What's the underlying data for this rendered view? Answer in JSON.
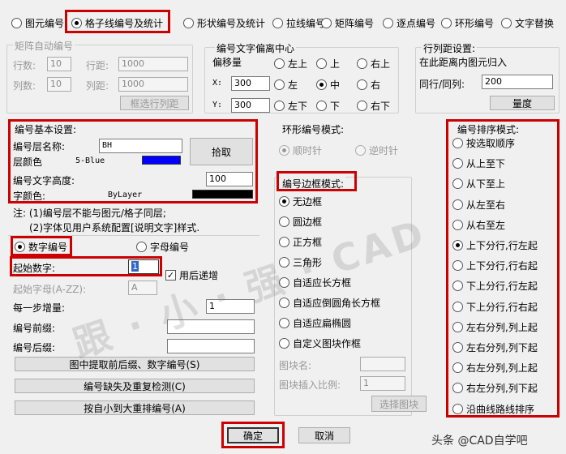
{
  "tabs": [
    {
      "label": "图元编号",
      "selected": false
    },
    {
      "label": "格子线编号及统计",
      "selected": true
    },
    {
      "label": "形状编号及统计",
      "selected": false
    },
    {
      "label": "拉线编号",
      "selected": false
    },
    {
      "label": "矩阵编号",
      "selected": false
    },
    {
      "label": "逐点编号",
      "selected": false
    },
    {
      "label": "环形编号",
      "selected": false
    },
    {
      "label": "文字替换",
      "selected": false
    }
  ],
  "matrix": {
    "title": "矩阵自动编号",
    "rows_label": "行数:",
    "rows_value": "10",
    "rowspace_label": "行距:",
    "rowspace_value": "1000",
    "cols_label": "列数:",
    "cols_value": "10",
    "colspace_label": "列距:",
    "colspace_value": "1000",
    "pick_button": "框选行列距"
  },
  "offset": {
    "title": "编号文字偏离中心",
    "move_label": "偏移量",
    "x_label": "X:",
    "x_value": "300",
    "y_label": "Y:",
    "y_value": "300",
    "positions": [
      "左上",
      "上",
      "右上",
      "左",
      "中",
      "右",
      "左下",
      "下",
      "右下"
    ],
    "selected": "中"
  },
  "rowcol": {
    "title": "行列距设置:",
    "desc": "在此距离内图元归入",
    "same_label": "同行/同列:",
    "same_value": "200",
    "measure_button": "量度"
  },
  "basic": {
    "title": "编号基本设置:",
    "layer_label": "编号层名称:",
    "layer_value": "BH",
    "pick_button": "拾取",
    "layer_color_label": "层颜色",
    "layer_color_text": "5-Blue",
    "layer_color": "#0000ff",
    "height_label": "编号文字高度:",
    "height_value": "100",
    "font_color_label": "字颜色:",
    "font_color_text": "ByLayer",
    "font_color": "#000000"
  },
  "note": {
    "line1": "注: (1)编号层不能与图元/格子同层;",
    "line2": "(2)字体见用户系统配置[说明文字]样式."
  },
  "numtype": {
    "digit_label": "数字编号",
    "alpha_label": "字母编号",
    "selected": "数字编号"
  },
  "start": {
    "label": "起始数字:",
    "value": "1",
    "autoinc_label": "用后递增",
    "autoinc_checked": true,
    "alpha_label": "起始字母(A-ZZ):",
    "alpha_value": "A",
    "step_label": "每一步增量:",
    "step_value": "1",
    "prefix_label": "编号前缀:",
    "prefix_value": "",
    "suffix_label": "编号后缀:",
    "suffix_value": ""
  },
  "actions": {
    "extract": "图中提取前后缀、数字编号(S)",
    "check": "编号缺失及重复检测(C)",
    "renumber": "按自小到大重排编号(A)"
  },
  "ring": {
    "title": "环形编号模式:",
    "cw": "顺时针",
    "ccw": "逆时针"
  },
  "frame": {
    "title": "编号边框模式:",
    "options": [
      "无边框",
      "圆边框",
      "正方框",
      "三角形",
      "自适应长方框",
      "自适应倒圆角长方框",
      "自适应扁椭圆",
      "自定义图块作框"
    ],
    "selected": "无边框",
    "block_name_label": "图块名:",
    "block_scale_label": "图块插入比例:",
    "block_scale_value": "1",
    "select_block_button": "选择图块"
  },
  "sort": {
    "title": "编号排序模式:",
    "options": [
      "按选取顺序",
      "从上至下",
      "从下至上",
      "从左至右",
      "从右至左",
      "上下分行,行左起",
      "上下分行,行右起",
      "下上分行,行左起",
      "下上分行,行右起",
      "左右分列,列上起",
      "左右分列,列下起",
      "右左分列,列上起",
      "右左分列,列下起",
      "沿曲线路线排序"
    ],
    "selected": "上下分行,行左起"
  },
  "footer": {
    "ok": "确定",
    "cancel": "取消"
  },
  "watermark": {
    "text": "跟 · 小 · 强 · CAD",
    "credit": "头条 @CAD自学吧"
  }
}
